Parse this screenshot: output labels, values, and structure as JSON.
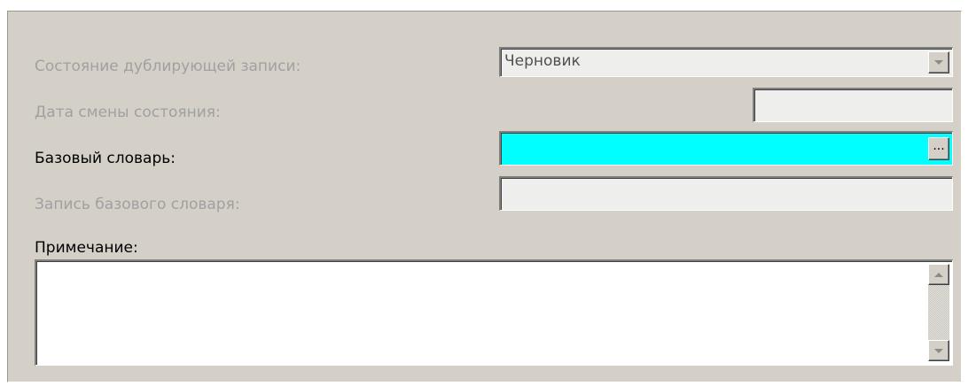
{
  "form": {
    "state_label": "Состояние дублирующей записи:",
    "state_value": "Черновик",
    "state_date_label": "Дата смены состояния:",
    "state_date_value": "",
    "base_dict_label": "Базовый словарь:",
    "base_dict_value": "",
    "base_dict_button": "...",
    "base_record_label": "Запись базового словаря:",
    "base_record_value": "",
    "note_label": "Примечание:",
    "note_value": ""
  },
  "colors": {
    "panel_bg": "#d4d0c8",
    "highlight_field": "#00ffff",
    "disabled_text": "#a0a0a0"
  },
  "icons": {
    "dropdown": "chevron-down-icon",
    "ellipsis": "ellipsis-icon",
    "scroll_up": "scroll-up-icon",
    "scroll_down": "scroll-down-icon"
  }
}
